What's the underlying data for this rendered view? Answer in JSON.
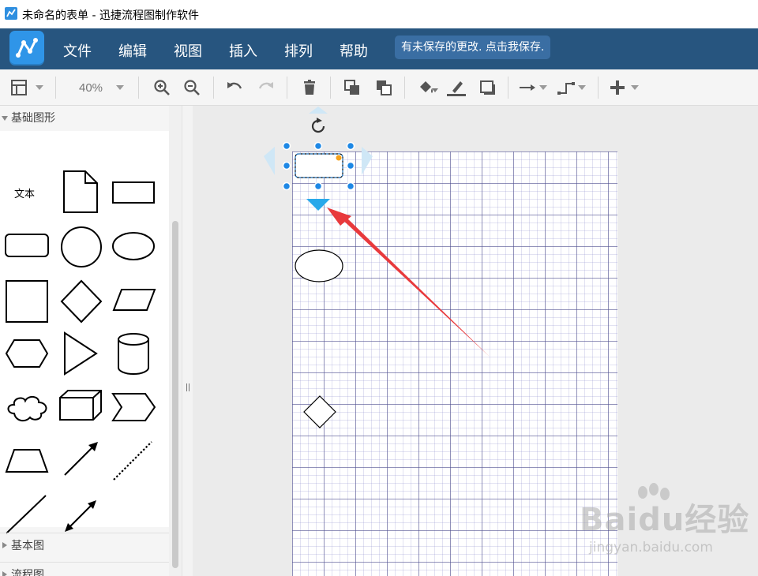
{
  "window": {
    "title": "未命名的表单 - 迅捷流程图制作软件"
  },
  "menu": {
    "items": [
      "文件",
      "编辑",
      "视图",
      "插入",
      "排列",
      "帮助"
    ],
    "unsaved_notice": "有未保存的更改. 点击我保存."
  },
  "toolbar": {
    "zoom": "40%",
    "icons": [
      "layout-icon",
      "zoom-in-icon",
      "zoom-out-icon",
      "undo-icon",
      "redo-icon",
      "delete-icon",
      "to-front-icon",
      "to-back-icon",
      "fill-color-icon",
      "line-color-icon",
      "shadow-icon",
      "connector-icon",
      "waypoints-icon",
      "insert-plus-icon"
    ]
  },
  "left_panel": {
    "sections": [
      {
        "label": "基础图形",
        "expanded": true
      },
      {
        "label": "基本图",
        "expanded": false
      },
      {
        "label": "流程图",
        "expanded": false
      }
    ],
    "text_shape_label": "文本"
  },
  "watermark": {
    "logo": "Baidu经验",
    "url": "jingyan.baidu.com"
  },
  "colors": {
    "menubar": "#27557f",
    "selection_handle": "#1e88e5",
    "arrow_hint": "#29a9ea",
    "annotation_arrow": "#e8393c"
  }
}
